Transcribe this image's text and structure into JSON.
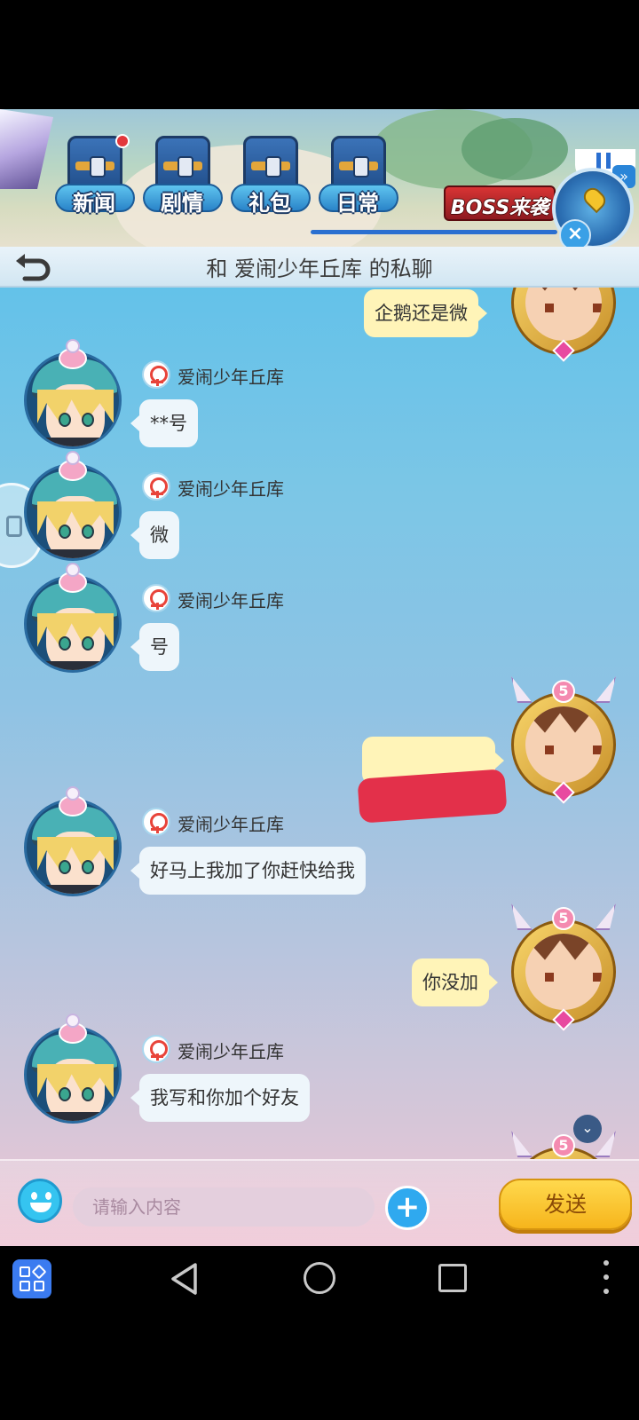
{
  "game_menu": {
    "news": "新闻",
    "story": "剧情",
    "gift": "礼包",
    "daily": "日常",
    "boss": "BOSS来袭"
  },
  "chat": {
    "title": "和 爱闹少年丘库 的私聊",
    "messages": [
      {
        "from": "me",
        "text": "企鹅还是微"
      },
      {
        "from": "other",
        "name": "爱闹少年丘库",
        "text": "**号"
      },
      {
        "from": "other",
        "name": "爱闹少年丘库",
        "text": "微"
      },
      {
        "from": "other",
        "name": "爱闹少年丘库",
        "text": "号"
      },
      {
        "from": "me",
        "text": "",
        "redacted": true,
        "level": "5"
      },
      {
        "from": "other",
        "name": "爱闹少年丘库",
        "text": "好马上我加了你赶快给我"
      },
      {
        "from": "me",
        "text": "你没加",
        "level": "5"
      },
      {
        "from": "other",
        "name": "爱闹少年丘库",
        "text": "我写和你加个好友"
      }
    ],
    "bottom_partial_level": "5"
  },
  "input_bar": {
    "placeholder": "请输入内容",
    "send_label": "发送"
  },
  "colors": {
    "my_bubble": "#fff4b8",
    "other_bubble": "#eef6fb",
    "send_button": "#f6b51c",
    "redaction": "#e3304a"
  }
}
